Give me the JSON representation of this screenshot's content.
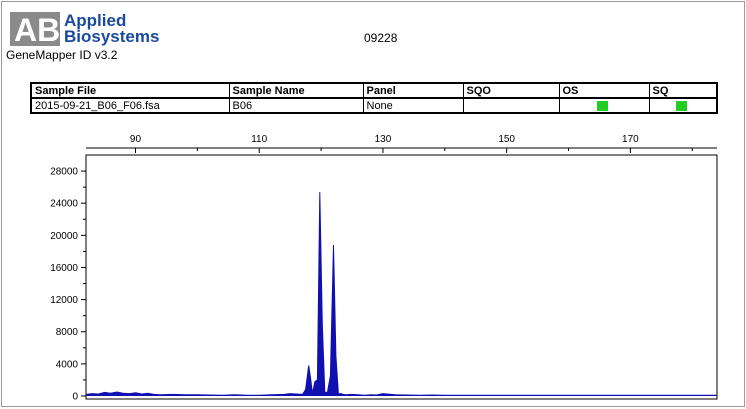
{
  "header": {
    "logo_line1": "Applied",
    "logo_line2": "Biosystems",
    "logo_mark": "AB",
    "app_name": "GeneMapper ID v3.2",
    "page_id": "09228"
  },
  "sample_table": {
    "columns": [
      "Sample File",
      "Sample Name",
      "Panel",
      "SQO",
      "OS",
      "SQ"
    ],
    "row": {
      "sample_file": "2015-09-21_B06_F06.fsa",
      "sample_name": "B06",
      "panel": "None",
      "sqo": "",
      "os_status": "green",
      "sq_status": "green"
    }
  },
  "colors": {
    "brand": "#1a4a9c",
    "trace": "#1010b0",
    "status_ok": "#22cc22"
  },
  "chart_data": {
    "type": "line",
    "title": "",
    "xlabel": "",
    "ylabel": "",
    "xlim": [
      82,
      184
    ],
    "ylim": [
      0,
      30000
    ],
    "x_ticks": [
      90,
      110,
      130,
      150,
      170
    ],
    "y_ticks": [
      0,
      4000,
      8000,
      12000,
      16000,
      20000,
      24000,
      28000
    ],
    "grid": false,
    "series": [
      {
        "color": "#1010b0",
        "x": [
          82,
          83,
          84,
          85,
          86,
          87,
          88,
          89,
          90,
          91,
          92,
          93,
          94,
          96,
          98,
          100,
          102,
          104,
          106,
          108,
          110,
          112,
          114,
          115,
          116,
          117,
          117.5,
          118,
          118.3,
          118.6,
          119,
          119.4,
          119.8,
          120.2,
          120.6,
          121,
          121.5,
          122,
          122.4,
          122.8,
          123.2,
          123.6,
          124,
          125,
          126,
          127,
          128,
          129,
          130,
          132,
          134,
          136,
          138,
          140,
          145,
          150,
          155,
          160,
          165,
          170,
          175,
          180,
          184
        ],
        "y": [
          200,
          300,
          250,
          450,
          350,
          500,
          350,
          300,
          400,
          250,
          350,
          200,
          150,
          200,
          150,
          150,
          120,
          100,
          150,
          100,
          100,
          150,
          200,
          300,
          250,
          200,
          800,
          3800,
          2200,
          300,
          1800,
          2000,
          25400,
          9000,
          500,
          400,
          2500,
          18800,
          5000,
          300,
          300,
          200,
          150,
          200,
          150,
          100,
          150,
          120,
          300,
          150,
          120,
          100,
          120,
          100,
          100,
          100,
          100,
          100,
          100,
          100,
          100,
          100,
          100
        ]
      }
    ]
  }
}
